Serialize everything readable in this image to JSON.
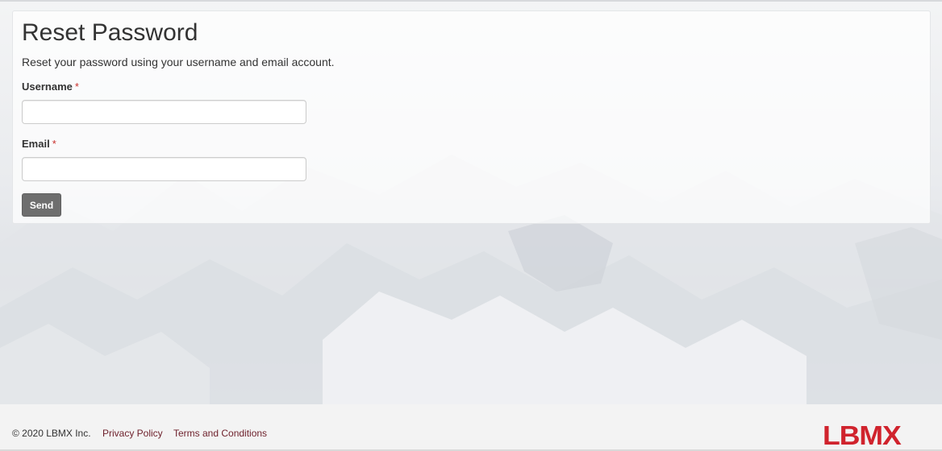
{
  "page": {
    "title": "Reset Password",
    "intro": "Reset your password using your username and email account."
  },
  "form": {
    "username_label": "Username",
    "username_value": "",
    "email_label": "Email",
    "email_value": "",
    "required_mark": "*",
    "send_label": "Send"
  },
  "footer": {
    "copyright": "© 2020 LBMX Inc.",
    "privacy_label": "Privacy Policy",
    "terms_label": "Terms and Conditions",
    "logo_text": "LBMX"
  },
  "colors": {
    "accent": "#d0232d",
    "link": "#6d1f2a",
    "button": "#6e6e6e",
    "required": "#c9302c"
  }
}
